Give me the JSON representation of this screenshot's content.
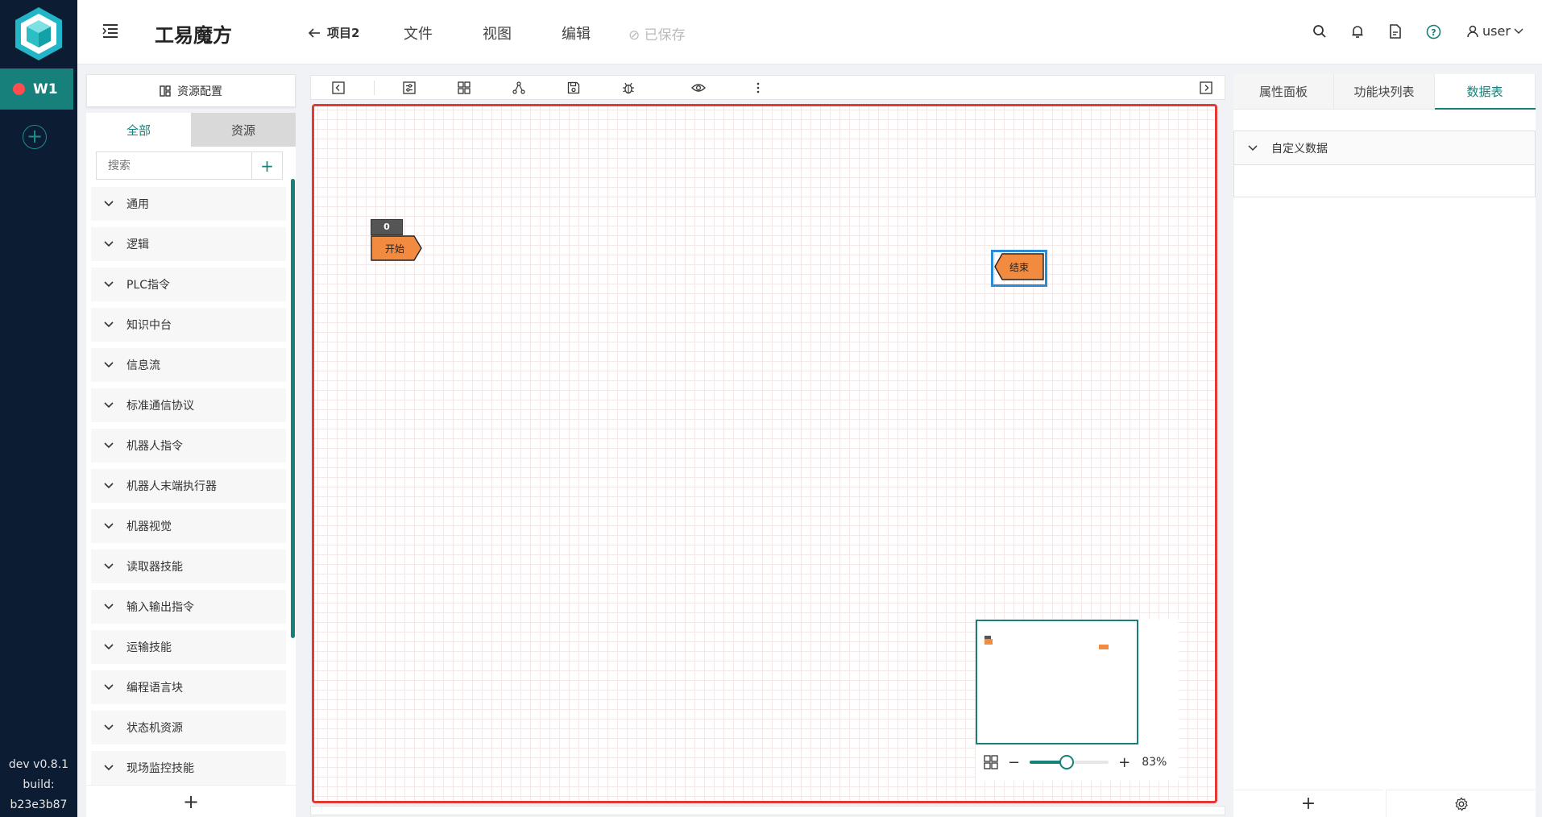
{
  "app": {
    "title": "工易魔方",
    "logo_icon": "cube-logo-icon"
  },
  "rail": {
    "workspace_label": "W1",
    "workspace_status_color": "#ff4d4f",
    "version_line1": "dev v0.8.1",
    "version_line2": "build:",
    "version_line3": "b23e3b87"
  },
  "header": {
    "back_label": "项目2",
    "menu": [
      "文件",
      "视图",
      "编辑"
    ],
    "saved_label": "已保存",
    "user_label": "user"
  },
  "left_panel": {
    "resource_config_label": "资源配置",
    "tabs": [
      "全部",
      "资源"
    ],
    "search_placeholder": "搜索",
    "categories": [
      "通用",
      "逻辑",
      "PLC指令",
      "知识中台",
      "信息流",
      "标准通信协议",
      "机器人指令",
      "机器人末端执行器",
      "机器视觉",
      "读取器技能",
      "输入输出指令",
      "运输技能",
      "编程语言块",
      "状态机资源",
      "现场监控技能"
    ]
  },
  "canvas": {
    "start_node": {
      "id": "0",
      "label": "开始",
      "color": "#f28a3f"
    },
    "end_node": {
      "label": "结束",
      "color": "#f28a3f",
      "selected_border": "#2a8bd6"
    },
    "border_color": "#e53935"
  },
  "zoom": {
    "value": 0.83,
    "label": "83%"
  },
  "right_panel": {
    "tabs": [
      "属性面板",
      "功能块列表",
      "数据表"
    ],
    "active_tab": "数据表",
    "section_title": "自定义数据"
  },
  "colors": {
    "accent": "#17807a",
    "rail_bg": "#0c1c33"
  }
}
